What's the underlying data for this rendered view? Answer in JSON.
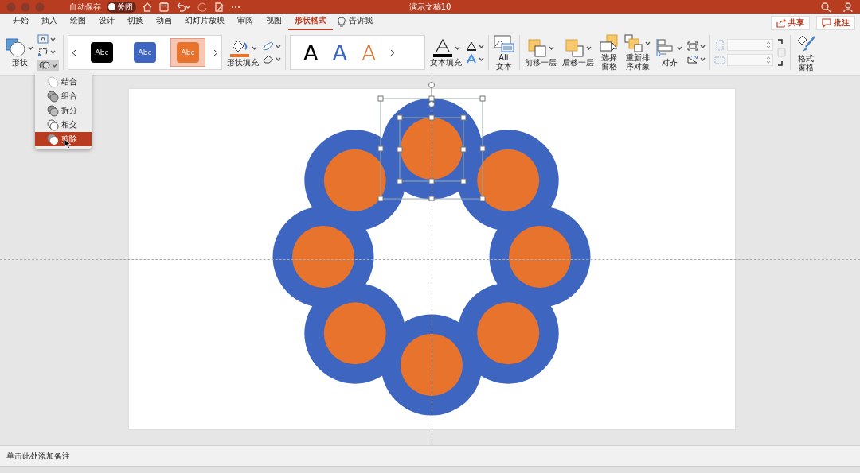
{
  "title_bar": {
    "autosave_label": "自动保存",
    "autosave_toggle": {
      "label": "关闭",
      "on": false
    },
    "title": "演示文稿10"
  },
  "menu_tabs": [
    {
      "label": "开始",
      "selected": false
    },
    {
      "label": "插入",
      "selected": false
    },
    {
      "label": "绘图",
      "selected": false
    },
    {
      "label": "设计",
      "selected": false
    },
    {
      "label": "切换",
      "selected": false
    },
    {
      "label": "动画",
      "selected": false
    },
    {
      "label": "幻灯片放映",
      "selected": false
    },
    {
      "label": "审阅",
      "selected": false
    },
    {
      "label": "视图",
      "selected": false
    },
    {
      "label": "形状格式",
      "selected": true
    }
  ],
  "tell_me": "告诉我",
  "share_button": "共享",
  "comments_button": "批注",
  "ribbon": {
    "shape_label": "形状",
    "style_presets": [
      {
        "label": "Abc",
        "color": "#000000",
        "selected": false
      },
      {
        "label": "Abc",
        "color": "#3e66c0",
        "selected": false
      },
      {
        "label": "Abc",
        "color": "#e8732c",
        "selected": true
      }
    ],
    "shape_fill_label": "形状填充",
    "wordart": [
      {
        "label": "A",
        "kind": "solid",
        "color": "#000000"
      },
      {
        "label": "A",
        "kind": "solid",
        "color": "#3e66c0"
      },
      {
        "label": "A",
        "kind": "outline",
        "color": "#e8732c"
      }
    ],
    "text_fill_label": "文本填充",
    "alt_text_label": [
      "Alt",
      "文本"
    ],
    "arrange_buttons": [
      {
        "label": "前移一层",
        "kind": "forward"
      },
      {
        "label": "后移一层",
        "kind": "backward"
      },
      {
        "label": [
          "选择",
          "窗格"
        ],
        "kind": "pane"
      },
      {
        "label": [
          "重新排",
          "序对象"
        ],
        "kind": "reorder"
      },
      {
        "label": "对齐",
        "kind": "align"
      }
    ],
    "format_pane_label": [
      "格式",
      "窗格"
    ]
  },
  "merge_menu": [
    {
      "label": "结合",
      "selected": false
    },
    {
      "label": "组合",
      "selected": false
    },
    {
      "label": "拆分",
      "selected": false
    },
    {
      "label": "相交",
      "selected": false
    },
    {
      "label": "剪除",
      "selected": true
    }
  ],
  "notes_placeholder": "单击此处添加备注"
}
